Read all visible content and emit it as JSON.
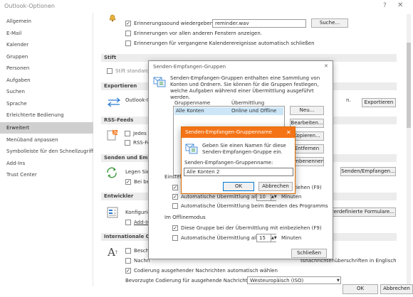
{
  "window": {
    "title": "Outlook-Optionen",
    "help": "?",
    "close": "✕"
  },
  "sidebar": {
    "items": [
      {
        "label": "Allgemein"
      },
      {
        "label": "E-Mail"
      },
      {
        "label": "Kalender"
      },
      {
        "label": "Gruppen"
      },
      {
        "label": "Personen"
      },
      {
        "label": "Aufgaben"
      },
      {
        "label": "Suchen"
      },
      {
        "label": "Sprache"
      },
      {
        "label": "Erleichterte Bedienung"
      },
      {
        "label": "Erweitert"
      },
      {
        "label": "Menüband anpassen"
      },
      {
        "label": "Symbolleiste für den Schnellzugriff"
      },
      {
        "label": "Add-Ins"
      },
      {
        "label": "Trust Center"
      }
    ],
    "selected": "Erweitert"
  },
  "main": {
    "reminder_sound_label": "Erinnerungssound wiedergeben:",
    "reminder_sound_value": "reminder.wav",
    "browse_button": "Suche...",
    "reminder_top_label": "Erinnerungen vor allen anderen Fenstern anzeigen.",
    "reminder_past_label": "Erinnerungen für vergangene Kalenderereignisse automatisch schließen",
    "section_pen": "Stift",
    "pen_default_label": "Stift standardm",
    "section_export": "Exportieren",
    "export_text": "Outlook-In",
    "export_text_end": "n.",
    "export_button": "Exportieren",
    "section_rss": "RSS-Feeds",
    "rss_label1": "Jedes R",
    "rss_label2": "RSS-Fe",
    "section_sendrecv": "Senden und Empfa",
    "sendrecv_text": "Legen Sie I",
    "sendrecv_cb": "Bei bes",
    "sendrecv_button": "Senden/Empfangen...",
    "section_dev": "Entwickler",
    "dev_text": "Konfigurie",
    "dev_cb": "Add-In",
    "custom_forms_button": "enutzerdefinierte Formulare...",
    "section_intl": "Internationale Opti",
    "intl_cb1": "Beschri",
    "intl_cb2_start": "Nachri",
    "intl_cb2_end": "tsnachrichtenüberschriften in Englisch",
    "intl_cb3": "Codierung ausgehender Nachrichten automatisch wählen",
    "intl_encoding_label": "Bevorzugte Codierung für ausgehende Nachrichten:",
    "intl_encoding_value": "Westeuropäisch (ISO)"
  },
  "footer": {
    "ok": "OK",
    "cancel": "Abbrechen"
  },
  "dialog_groups": {
    "title": "Senden-Empfangen-Gruppen",
    "close": "✕",
    "description": "Senden-Empfangen-Gruppen enthalten eine Sammlung von Konten und Ordnern. Sie können für die Gruppen festlegen, welche Aufgaben während einer Übermittlung ausgeführt werden.",
    "col_group": "Gruppenname",
    "col_transfer": "Übermittlung",
    "rows": [
      {
        "name": "Alle Konten",
        "transfer": "Online und Offline"
      }
    ],
    "btn_new": "Neu...",
    "btn_edit": "Bearbeiten...",
    "btn_copy": "Kopieren...",
    "btn_remove": "Entfernen",
    "btn_rename": "Umbenennen",
    "settings_label": "Einstellungen",
    "online_include": "Diese Gruppe bei der Übermittlung mit einbeziehen (F9)",
    "online_auto_label": "Automatische Übermittlung alle",
    "online_auto_value": "10",
    "minutes": "Minuten",
    "online_exit": "Automatische Übermittlung beim Beenden des Programms",
    "offline_heading": "Im Offlinemodus",
    "offline_include": "Diese Gruppe bei der Übermittlung mit einbeziehen (F9)",
    "offline_auto_label": "Automatische Übermittlung alle",
    "offline_auto_value": "15",
    "close_button": "Schließen"
  },
  "dialog_name": {
    "title": "Senden-Empfangen-Gruppenname",
    "close": "✕",
    "description": "Geben Sie einen Namen für diese Senden-Empfangen-Gruppe ein.",
    "field_label": "Senden-Empfangen-Gruppenname:",
    "field_value": "Alle Konten 2",
    "ok": "OK",
    "cancel": "Abbrechen"
  },
  "colors": {
    "accent": "#f47316",
    "selection": "#cfcfcf"
  }
}
